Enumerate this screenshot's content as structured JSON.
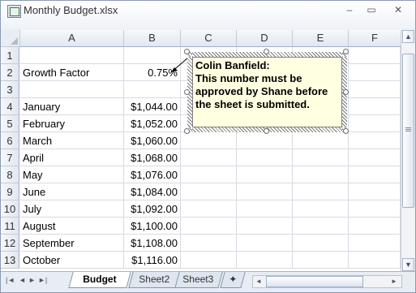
{
  "window": {
    "title": "Monthly Budget.xlsx",
    "minimize": "–",
    "maximize": "▭",
    "close": "✕"
  },
  "columns": [
    "A",
    "B",
    "C",
    "D",
    "E",
    "F"
  ],
  "rows": [
    {
      "num": "1",
      "a": "",
      "b": ""
    },
    {
      "num": "2",
      "a": "Growth Factor",
      "b": "0.75%"
    },
    {
      "num": "3",
      "a": "",
      "b": ""
    },
    {
      "num": "4",
      "a": "January",
      "b": "$1,044.00"
    },
    {
      "num": "5",
      "a": "February",
      "b": "$1,052.00"
    },
    {
      "num": "6",
      "a": "March",
      "b": "$1,060.00"
    },
    {
      "num": "7",
      "a": "April",
      "b": "$1,068.00"
    },
    {
      "num": "8",
      "a": "May",
      "b": "$1,076.00"
    },
    {
      "num": "9",
      "a": "June",
      "b": "$1,084.00"
    },
    {
      "num": "10",
      "a": "July",
      "b": "$1,092.00"
    },
    {
      "num": "11",
      "a": "August",
      "b": "$1,100.00"
    },
    {
      "num": "12",
      "a": "September",
      "b": "$1,108.00"
    },
    {
      "num": "13",
      "a": "October",
      "b": "$1,116.00"
    }
  ],
  "comment": {
    "author": "Colin Banfield:",
    "lines": [
      "This number must be",
      "approved by Shane before",
      "the sheet is submitted."
    ]
  },
  "sheet_nav": [
    "|◄",
    "◄",
    "►",
    "►|"
  ],
  "tabs": [
    "Budget",
    "Sheet2",
    "Sheet3"
  ],
  "active_tab": "Budget",
  "scroll": {
    "up": "▲",
    "down": "▼",
    "left": "◄",
    "right": "►"
  }
}
